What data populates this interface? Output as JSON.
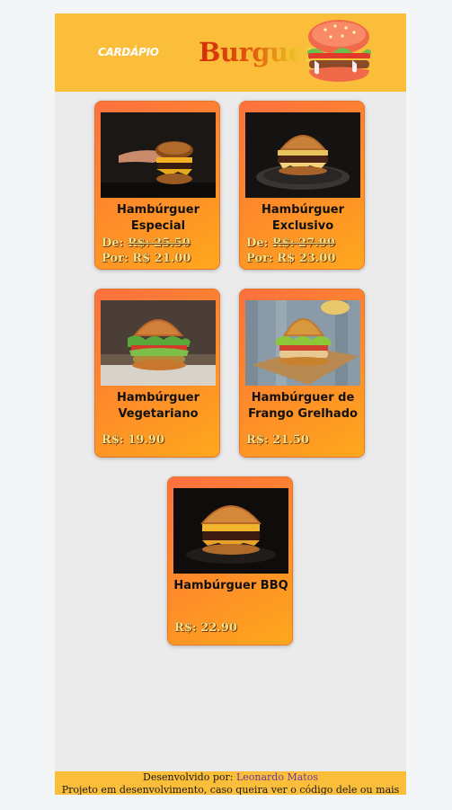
{
  "header": {
    "menu_label": "CARDÁPIO",
    "brand": "Burguer"
  },
  "products": [
    {
      "name": "Hambúrguer Especial",
      "old_price_prefix": "De: ",
      "old_price": "R$: 25.50",
      "price_prefix": "Por: ",
      "price": "R$ 21.00"
    },
    {
      "name": "Hambúrguer Exclusivo",
      "old_price_prefix": "De: ",
      "old_price": "R$: 27.90",
      "price_prefix": "Por: ",
      "price": "R$ 23.00"
    },
    {
      "name": "Hambúrguer Vegetariano",
      "price": "R$: 19.90"
    },
    {
      "name": "Hambúrguer de Frango Grelhado",
      "price": "R$: 21.50"
    },
    {
      "name": "Hambúrguer BBQ",
      "price": "R$: 22.90"
    }
  ],
  "footer": {
    "developed_by": "Desenvolvido por: ",
    "author": "Leonardo Matos",
    "note": "Projeto em desenvolvimento, caso queira ver o código dele ou mais"
  },
  "colors": {
    "header_bg": "#fbbe3a",
    "card_start": "#fe7040",
    "card_end": "#fea81c",
    "price_text": "#f8e38c",
    "link": "#6b3aa0"
  }
}
